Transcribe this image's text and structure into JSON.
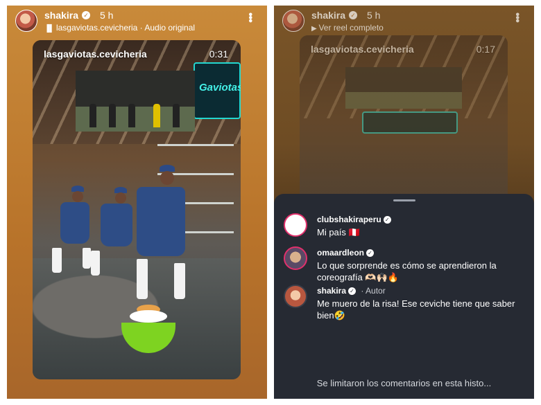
{
  "left": {
    "username": "shakira",
    "time": "5 h",
    "audio": "lasgaviotas.cevicheria · Audio original",
    "video_tag": "lasgaviotas.cevicheria",
    "video_time": "0:31",
    "sign_text": "Gaviotas"
  },
  "right": {
    "username": "shakira",
    "time": "5 h",
    "reel_link": "Ver reel completo",
    "video_tag": "lasgaviotas.cevicheria",
    "video_time": "0:17",
    "comments": [
      {
        "user": "clubshakiraperu",
        "text": "Mi país 🇵🇪"
      },
      {
        "user": "omaardleon",
        "text": "Lo que sorprende es cómo se aprendieron la coreografía 🫶🏻🙌🏻🔥"
      },
      {
        "user": "shakira",
        "tag": "· Autor",
        "text": "Me muero de la risa! Ese ceviche tiene que saber bien🤣"
      }
    ],
    "limited_note": "Se limitaron los comentarios en esta histo..."
  },
  "colors": {
    "accent_ring": "#e1306c",
    "sheet_bg": "#262a33",
    "neon": "#23d7d0"
  },
  "icons": [
    "verified-badge-icon",
    "more-options-icon",
    "audio-icon",
    "reel-icon"
  ]
}
